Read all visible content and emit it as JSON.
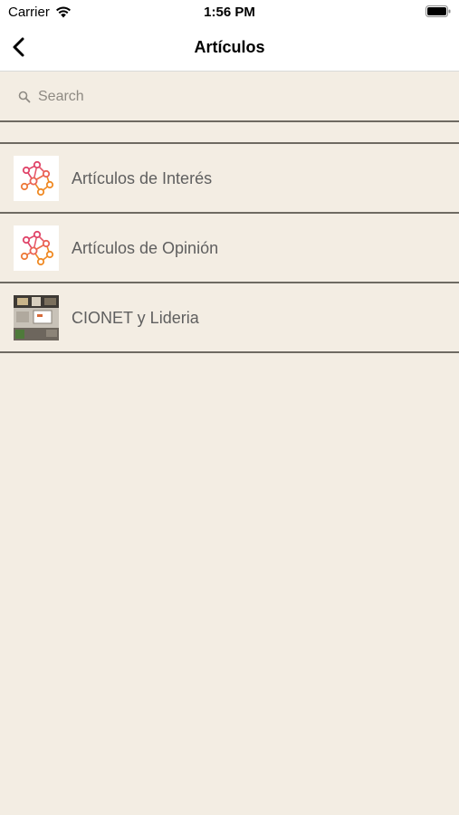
{
  "status_bar": {
    "carrier": "Carrier",
    "time": "1:56 PM"
  },
  "nav": {
    "title": "Artículos",
    "back_icon": "chevron-left-icon"
  },
  "search": {
    "placeholder": "Search",
    "value": ""
  },
  "items": [
    {
      "label": "Artículos de Interés",
      "thumbnail": "network-graph-icon"
    },
    {
      "label": "Artículos de Opinión",
      "thumbnail": "network-graph-icon"
    },
    {
      "label": "CIONET y Lideria",
      "thumbnail": "office-photo"
    }
  ],
  "colors": {
    "background": "#f3ede3",
    "divider": "#6e6a62",
    "label": "#5f5f5f",
    "graph_pink": "#e0456a",
    "graph_orange": "#f08a24"
  }
}
